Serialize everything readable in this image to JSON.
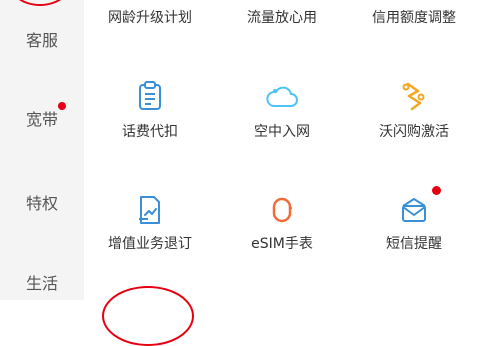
{
  "sidebar": {
    "items": [
      {
        "label": "客服"
      },
      {
        "label": "宽带"
      },
      {
        "label": "特权"
      },
      {
        "label": "生活"
      }
    ]
  },
  "grid": {
    "row1": [
      "网龄升级计划",
      "流量放心用",
      "信用额度调整"
    ],
    "row2": [
      "话费代扣",
      "空中入网",
      "沃闪购激活"
    ],
    "row3": [
      "增值业务退订",
      "eSIM手表",
      "短信提醒"
    ]
  },
  "colors": {
    "accent": "#e60012",
    "icon_blue": "#3a8fd9",
    "icon_sky": "#4fc3f7",
    "icon_orange": "#f5a623",
    "sidebar_bg": "#f4f4f4"
  },
  "icons": {
    "r2c1": "clipboard-icon",
    "r2c2": "cloud-icon",
    "r2c3": "lightning-icon",
    "r3c1": "refund-document-icon",
    "r3c2": "watch-icon",
    "r3c3": "envelope-icon"
  }
}
